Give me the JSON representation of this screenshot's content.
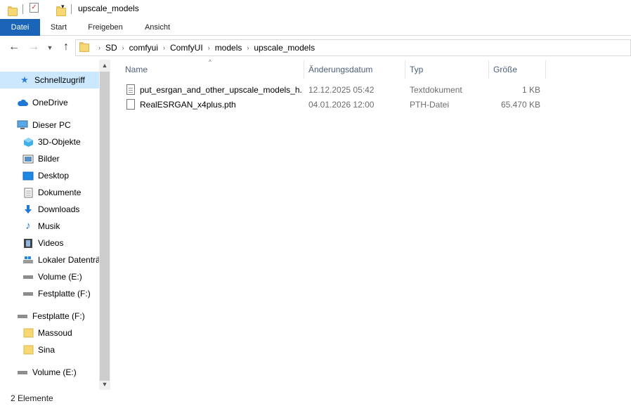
{
  "window": {
    "title": "upscale_models"
  },
  "quick_access": {
    "dropdown_icon": "chevron-down-icon"
  },
  "ribbon": {
    "tabs": [
      "Datei",
      "Start",
      "Freigeben",
      "Ansicht"
    ]
  },
  "navigation": {
    "back_icon": "←",
    "forward_icon": "→",
    "recent_icon": "⌄",
    "up_icon": "↑",
    "breadcrumbs": [
      "SD",
      "comfyui",
      "ComfyUI",
      "models",
      "upscale_models"
    ],
    "separator": "›"
  },
  "sidebar": {
    "items": [
      {
        "label": "Schnellzugriff",
        "icon": "star-icon"
      },
      {
        "label": "OneDrive",
        "icon": "cloud-icon"
      },
      {
        "label": "Dieser PC",
        "icon": "monitor-icon"
      },
      {
        "label": "3D-Objekte",
        "icon": "cube-icon"
      },
      {
        "label": "Bilder",
        "icon": "picture-icon"
      },
      {
        "label": "Desktop",
        "icon": "desktop-icon"
      },
      {
        "label": "Dokumente",
        "icon": "document-icon"
      },
      {
        "label": "Downloads",
        "icon": "download-icon"
      },
      {
        "label": "Musik",
        "icon": "music-icon"
      },
      {
        "label": "Videos",
        "icon": "video-icon"
      },
      {
        "label": "Lokaler Datenträ",
        "icon": "local-disk-icon"
      },
      {
        "label": "Volume (E:)",
        "icon": "drive-icon"
      },
      {
        "label": "Festplatte  (F:)",
        "icon": "drive-icon"
      },
      {
        "label": "Festplatte  (F:)",
        "icon": "drive-icon"
      },
      {
        "label": "Massoud",
        "icon": "folder-icon"
      },
      {
        "label": "Sina",
        "icon": "folder-icon"
      },
      {
        "label": "Volume (E:)",
        "icon": "drive-icon"
      }
    ]
  },
  "columns": {
    "name": "Name",
    "date": "Änderungsdatum",
    "type": "Typ",
    "size": "Größe"
  },
  "files": [
    {
      "name": "put_esrgan_and_other_upscale_models_h...",
      "date": "12.12.2025 05:42",
      "type": "Textdokument",
      "size": "1 KB",
      "icon": "text-file-icon"
    },
    {
      "name": "RealESRGAN_x4plus.pth",
      "date": "04.01.2026 12:00",
      "type": "PTH-Datei",
      "size": "65.470 KB",
      "icon": "file-icon"
    }
  ],
  "status": {
    "count": "2 Elemente"
  },
  "colors": {
    "file_tab": "#1a65b8",
    "selected": "#cce8ff",
    "header_text": "#4c607a"
  }
}
